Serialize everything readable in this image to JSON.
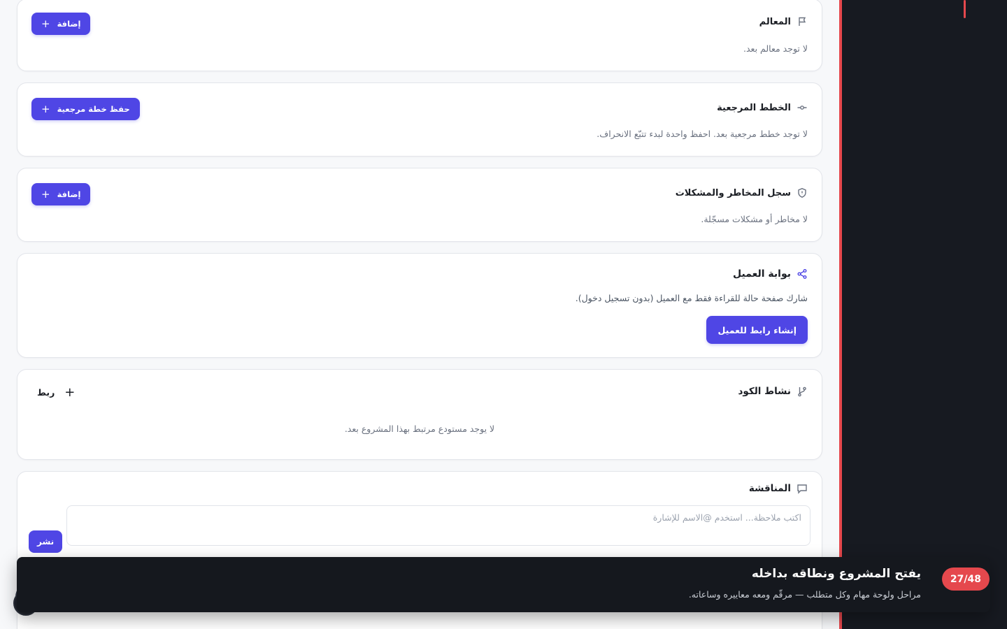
{
  "milestones": {
    "title": "المعالم",
    "empty": "لا توجد معالم بعد.",
    "add_label": "إضافة"
  },
  "baselines": {
    "title": "الخطط المرجعية",
    "empty": "لا توجد خطط مرجعية بعد. احفظ واحدة لبدء تتبّع الانحراف.",
    "save_label": "حفظ خطة مرجعية"
  },
  "risks": {
    "title": "سجل المخاطر والمشكلات",
    "empty": "لا مخاطر أو مشكلات مسجّلة.",
    "add_label": "إضافة"
  },
  "client_portal": {
    "title": "بوابة العميل",
    "description": "شارك صفحة حالة للقراءة فقط مع العميل (بدون تسجيل دخول).",
    "create_link_label": "إنشاء رابط للعميل"
  },
  "code_activity": {
    "title": "نشاط الكود",
    "link_label": "ربط",
    "empty": "لا يوجد مستودع مرتبط بهذا المشروع بعد."
  },
  "discussion": {
    "title": "المناقشة",
    "placeholder": "اكتب ملاحظة... استخدم @الاسم للإشارة",
    "post_label": "نشر"
  },
  "tour": {
    "step": "27/48",
    "title": "يفتح المشروع ونطاقه بداخله",
    "description": "مراحل ولوحة مهام وكل متطلب — مرقّم ومعه معاييره وساعاته."
  },
  "colors": {
    "primary": "#4f46e5",
    "danger": "#e5484d",
    "rail": "#171a21"
  }
}
